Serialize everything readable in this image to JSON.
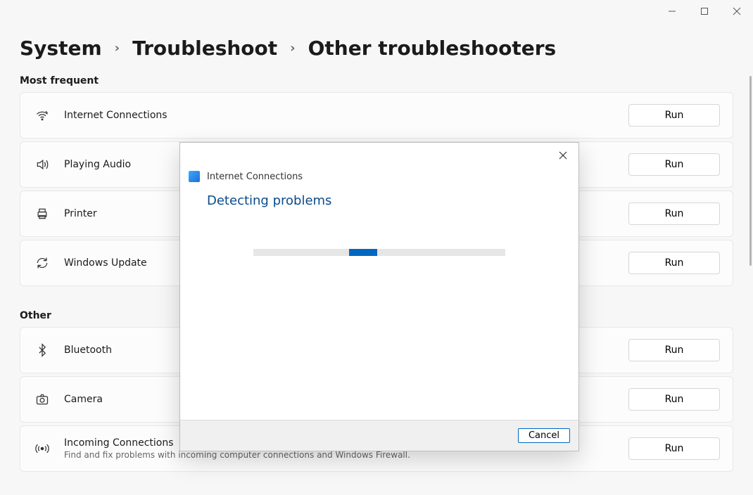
{
  "window_controls": {
    "minimize": "minimize",
    "maximize": "maximize",
    "close": "close"
  },
  "breadcrumb": {
    "level1": "System",
    "level2": "Troubleshoot",
    "current": "Other troubleshooters"
  },
  "sections": {
    "most_frequent": {
      "heading": "Most frequent"
    },
    "other": {
      "heading": "Other"
    }
  },
  "troubleshooters": {
    "internet": {
      "title": "Internet Connections",
      "run": "Run"
    },
    "audio": {
      "title": "Playing Audio",
      "run": "Run"
    },
    "printer": {
      "title": "Printer",
      "run": "Run"
    },
    "winupdate": {
      "title": "Windows Update",
      "run": "Run"
    },
    "bluetooth": {
      "title": "Bluetooth",
      "run": "Run"
    },
    "camera": {
      "title": "Camera",
      "run": "Run"
    },
    "incoming": {
      "title": "Incoming Connections",
      "sub": "Find and fix problems with incoming computer connections and Windows Firewall.",
      "run": "Run"
    }
  },
  "dialog": {
    "header": "Internet Connections",
    "title": "Detecting problems",
    "cancel": "Cancel"
  }
}
